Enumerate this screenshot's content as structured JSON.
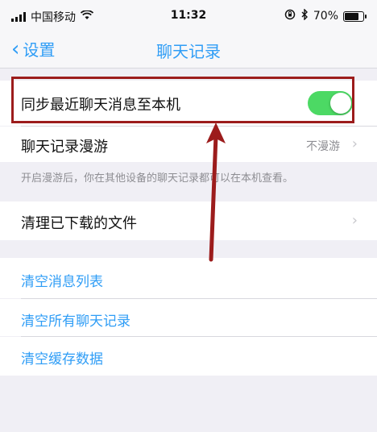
{
  "status": {
    "carrier": "中国移动",
    "time": "11:32",
    "battery": "70%"
  },
  "nav": {
    "back_label": "设置",
    "title": "聊天记录"
  },
  "rows": {
    "sync_label": "同步最近聊天消息至本机",
    "sync_on": true,
    "roaming_label": "聊天记录漫游",
    "roaming_value": "不漫游",
    "roaming_note": "开启漫游后，你在其他设备的聊天记录都可以在本机查看。",
    "clear_files_label": "清理已下载的文件",
    "clear_list_label": "清空消息列表",
    "clear_all_label": "清空所有聊天记录",
    "clear_cache_label": "清空缓存数据"
  },
  "colors": {
    "accent": "#2f9df6",
    "toggle_on": "#4cd964",
    "annotation": "#9c1c1c"
  }
}
